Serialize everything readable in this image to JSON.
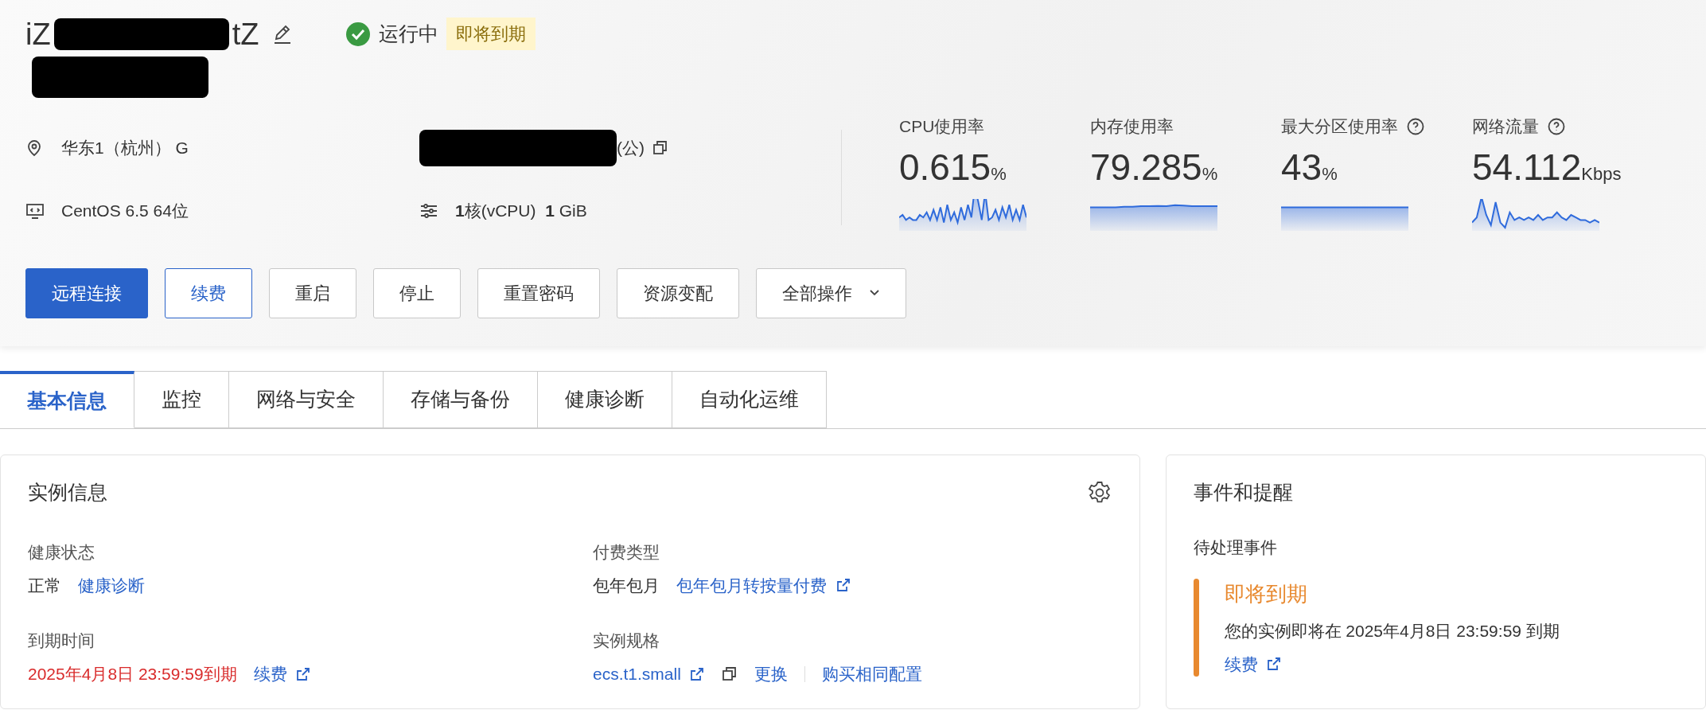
{
  "header": {
    "title_start": "iZ",
    "title_end": "tZ",
    "status": "运行中",
    "expiry_badge": "即将到期",
    "info": [
      {
        "kind": "region",
        "text": "华东1（杭州） G"
      },
      {
        "kind": "ip",
        "text": "(公)"
      },
      {
        "kind": "os",
        "text": "CentOS 6.5 64位"
      },
      {
        "kind": "spec",
        "text": "**1**核(vCPU)  **1** GiB"
      }
    ],
    "buttons": [
      {
        "label": "远程连接",
        "kind": "primary"
      },
      {
        "label": "续费",
        "kind": "outline"
      },
      {
        "label": "重启",
        "kind": "default"
      },
      {
        "label": "停止",
        "kind": "default"
      },
      {
        "label": "重置密码",
        "kind": "default"
      },
      {
        "label": "资源变配",
        "kind": "default"
      },
      {
        "label": "全部操作",
        "kind": "dropdown"
      }
    ],
    "metrics": [
      {
        "label": "CPU使用率",
        "value": "0.615",
        "unit": "%",
        "help": false
      },
      {
        "label": "内存使用率",
        "value": "79.285",
        "unit": "%",
        "help": false
      },
      {
        "label": "最大分区使用率",
        "value": "43",
        "unit": "%",
        "help": true
      },
      {
        "label": "网络流量",
        "value": "54.112",
        "unit": "Kbps",
        "help": true
      }
    ]
  },
  "tabs": [
    {
      "label": "基本信息",
      "selected": true
    },
    {
      "label": "监控",
      "selected": false
    },
    {
      "label": "网络与安全",
      "selected": false
    },
    {
      "label": "存储与备份",
      "selected": false
    },
    {
      "label": "健康诊断",
      "selected": false
    },
    {
      "label": "自动化运维",
      "selected": false
    }
  ],
  "instance_card": {
    "title": "实例信息",
    "fields": [
      {
        "label": "健康状态",
        "value": "正常",
        "links": [
          {
            "text": "健康诊断",
            "external": false
          }
        ]
      },
      {
        "label": "付费类型",
        "value": "包年包月",
        "links": [
          {
            "text": "包年包月转按量付费",
            "external": true
          }
        ]
      },
      {
        "label": "到期时间",
        "value": "2025年4月8日 23:59:59到期",
        "warning": true,
        "links": [
          {
            "text": "续费",
            "external": true
          }
        ]
      },
      {
        "label": "实例规格",
        "links": [
          {
            "text": "ecs.t1.small",
            "external": true,
            "copy": true
          },
          {
            "text": "更换",
            "external": false
          },
          {
            "text": "购买相同配置",
            "external": false
          }
        ]
      }
    ]
  },
  "events_card": {
    "title": "事件和提醒",
    "section": "待处理事件",
    "events": [
      {
        "title": "即将到期",
        "color": "#e8892f",
        "message": "您的实例即将在 2025年4月8日 23:59:59 到期",
        "link": "续费"
      }
    ]
  }
}
